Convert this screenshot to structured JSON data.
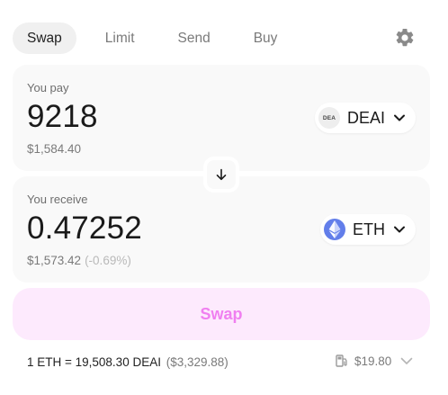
{
  "tabs": [
    {
      "label": "Swap",
      "active": true
    },
    {
      "label": "Limit",
      "active": false
    },
    {
      "label": "Send",
      "active": false
    },
    {
      "label": "Buy",
      "active": false
    }
  ],
  "settings_icon": "gear-icon",
  "pay": {
    "label": "You pay",
    "amount": "9218",
    "usd_value": "$1,584.40",
    "token": {
      "symbol": "DEAI",
      "logo_text": "DEA",
      "logo_color": "#eeeeee"
    }
  },
  "receive": {
    "label": "You receive",
    "amount": "0.47252",
    "usd_value": "$1,573.42",
    "price_impact": "(-0.69%)",
    "token": {
      "symbol": "ETH",
      "logo_color": "#627eea"
    }
  },
  "switch_icon": "arrow-down-icon",
  "swap_button": {
    "label": "Swap",
    "bg_color": "#fdeafd",
    "text_color": "#f07ff0"
  },
  "rate": {
    "text": "1 ETH = 19,508.30 DEAI",
    "usd": "($3,329.88)"
  },
  "gas": {
    "icon": "gas-pump-icon",
    "value": "$19.80"
  }
}
